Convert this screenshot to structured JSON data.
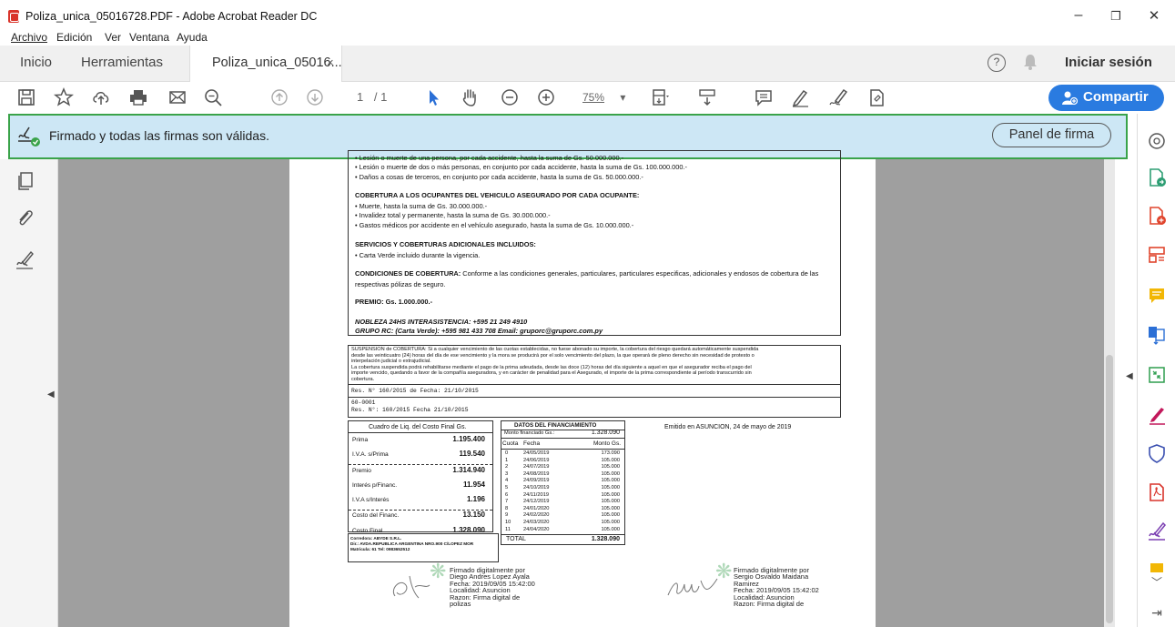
{
  "window": {
    "title": "Poliza_unica_05016728.PDF - Adobe Acrobat Reader DC",
    "controls": [
      "–",
      "❐",
      "✕"
    ]
  },
  "menu": [
    "Archivo",
    "Edición",
    "Ver",
    "Ventana",
    "Ayuda"
  ],
  "tabs": {
    "home": "Inicio",
    "tools": "Herramientas",
    "doc": "Poliza_unica_05016...",
    "close": "×"
  },
  "header": {
    "help": "?",
    "signin": "Iniciar sesión"
  },
  "toolbar": {
    "page_current": "1",
    "page_sep": "/ 1",
    "zoom": "75%",
    "zoom_caret": "▾",
    "share": "Compartir"
  },
  "signature_bar": {
    "message": "Firmado y todas las firmas son válidas.",
    "panel_button": "Panel de firma"
  },
  "document": {
    "lines_top": [
      "• Lesión o muerte de una persona, por cada accidente, hasta la suma de Gs. 50.000.000.-",
      "• Lesión o muerte de dos o más personas, en conjunto por cada accidente, hasta la suma de Gs. 100.000.000.-",
      "• Daños a cosas de terceros, en conjunto por cada accidente, hasta la suma de Gs. 50.000.000.-"
    ],
    "cov_occupants_title": "COBERTURA A LOS OCUPANTES DEL VEHICULO ASEGURADO POR CADA OCUPANTE:",
    "cov_occupants": [
      "• Muerte, hasta la suma de Gs. 30.000.000.-",
      "• Invalidez total y permanente, hasta la suma de Gs. 30.000.000.-",
      "• Gastos médicos por accidente en el vehículo asegurado, hasta la suma de Gs. 10.000.000.-"
    ],
    "services_title": "SERVICIOS Y COBERTURAS ADICIONALES INCLUIDOS:",
    "services": [
      "• Carta Verde incluido durante la vigencia."
    ],
    "conditions_label": "CONDICIONES DE COBERTURA:",
    "conditions_text": " Conforme a las condiciones generales, particulares, particulares especificas, adicionales y endosos de cobertura de las",
    "conditions_text2": "respectivas pólizas de seguro.",
    "premio": "PREMIO: Gs. 1.000.000.-",
    "nobleza": "NOBLEZA 24HS INTERASISTENCIA: +595 21 249 4910",
    "grupo": "GRUPO RC: (Carta Verde): +595 981 433 708 Email: gruporc@gruporc.com.py",
    "suspension": [
      "SUSPENSION de COBERTURA: Si a cualquier vencimiento de las cuotas establecidas, no fuese abonado su importe, la cobertura del riesgo quedará automáticamente suspendida",
      "desde las veinticuatro (24) horas del día de ese vencimiento y la mora se producirá por el solo vencimiento del plazo, la que operará de pleno derecho sin necesidad de protesto o",
      "interpelación judicial o extrajudicial.",
      "La cobertura suspendida podrá rehabilitarse mediante el pago de la prima adeudada, desde las doce (12) horas del día siguiente a aquel en que el asegurador reciba el pago del",
      "importe vencido, quedando a favor de la compañía aseguradora, y en carácter de penalidad para el Asegurado, el importe de la prima correspondiente al período transcurrido sin",
      "cobertura."
    ],
    "res1": "Res. N° 160/2015 de Fecha: 21/10/2015",
    "res2": "60-0001",
    "res3": "Res. N°: 160/2015 Fecha 21/10/2015",
    "liq_title": "Cuadro de Liq. del Costo Final Gs.",
    "liq_rows": [
      {
        "k": "Prima",
        "v": "1.195.400"
      },
      {
        "k": "I.V.A. s/Prima",
        "v": "119.540"
      },
      {
        "k": "Premio",
        "v": "1.314.940"
      },
      {
        "k": "Interés p/Financ.",
        "v": "11.954"
      },
      {
        "k": "I.V.A s/Interés",
        "v": "1.196"
      },
      {
        "k": "Costo del Financ.",
        "v": "13.150"
      },
      {
        "k": "Costo Final",
        "v": "1.328.090"
      }
    ],
    "fin_title": "DATOS DEL FINANCIAMIENTO",
    "fin_monto_label": "Monto financiado Gs.:",
    "fin_monto": "1.328.090",
    "fin_headers": [
      "Cuota",
      "Fecha",
      "Monto  Gs."
    ],
    "fin_rows": [
      [
        "0",
        "24/05/2019",
        "173.090"
      ],
      [
        "1",
        "24/06/2019",
        "105.000"
      ],
      [
        "2",
        "24/07/2019",
        "105.000"
      ],
      [
        "3",
        "24/08/2019",
        "105.000"
      ],
      [
        "4",
        "24/09/2019",
        "105.000"
      ],
      [
        "5",
        "24/10/2019",
        "105.000"
      ],
      [
        "6",
        "24/11/2019",
        "105.000"
      ],
      [
        "7",
        "24/12/2019",
        "105.000"
      ],
      [
        "8",
        "24/01/2020",
        "105.000"
      ],
      [
        "9",
        "24/02/2020",
        "105.000"
      ],
      [
        "10",
        "24/03/2020",
        "105.000"
      ],
      [
        "11",
        "24/04/2020",
        "105.000"
      ]
    ],
    "fin_total_label": "TOTAL",
    "fin_total": "1.328.090",
    "emitido": "Emitido en ASUNCION, 24 de mayo de 2019",
    "corredora_l1": "Corredora:      ABYDE S.R.L.",
    "corredora_l2": "Dir.:   AVDA.REPUBLICA ARGENTINA NRO.900 C/LOPEZ MOR",
    "corredora_l3": "Matricula:     61          Tel:   0983652512",
    "sig1": [
      "Firmado digitalmente por",
      "Diego Andres Lopez Ayala",
      "Fecha: 2019/09/05 15:42:00",
      "Localidad: Asuncion",
      "Razon: Firma digital de",
      "polizas"
    ],
    "sig2": [
      "Firmado digitalmente por",
      "Sergio Osvaldo Maidana",
      "Ramirez",
      "Fecha: 2019/09/05 15:42:02",
      "Localidad: Asuncion",
      "Razon: Firma digital de"
    ]
  }
}
